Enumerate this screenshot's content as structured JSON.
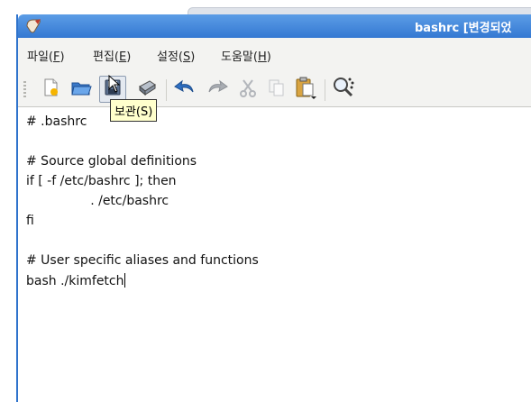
{
  "window": {
    "title": "bashrc [변경되었"
  },
  "menubar": {
    "items": [
      {
        "label": "파일(",
        "accel": "F",
        "suffix": ")"
      },
      {
        "label": "편집(",
        "accel": "E",
        "suffix": ")"
      },
      {
        "label": "설정(",
        "accel": "S",
        "suffix": ")"
      },
      {
        "label": "도움말(",
        "accel": "H",
        "suffix": ")"
      }
    ]
  },
  "toolbar": {
    "tooltip": "보관(S)",
    "buttons": [
      "new-document-icon",
      "open-folder-icon",
      "save-icon",
      "print-icon",
      "undo-icon",
      "redo-icon",
      "cut-icon",
      "copy-icon",
      "paste-icon",
      "find-icon"
    ]
  },
  "editor": {
    "lines": [
      "# .bashrc",
      "",
      "# Source global definitions",
      "if [ -f /etc/bashrc ]; then",
      "                . /etc/bashrc",
      "fi",
      "",
      "# User specific aliases and functions",
      "bash ./kimfetch"
    ]
  },
  "colors": {
    "titlebar": "#3478d2",
    "tooltip_bg": "#ffffcc",
    "accent": "#2f73cc"
  }
}
